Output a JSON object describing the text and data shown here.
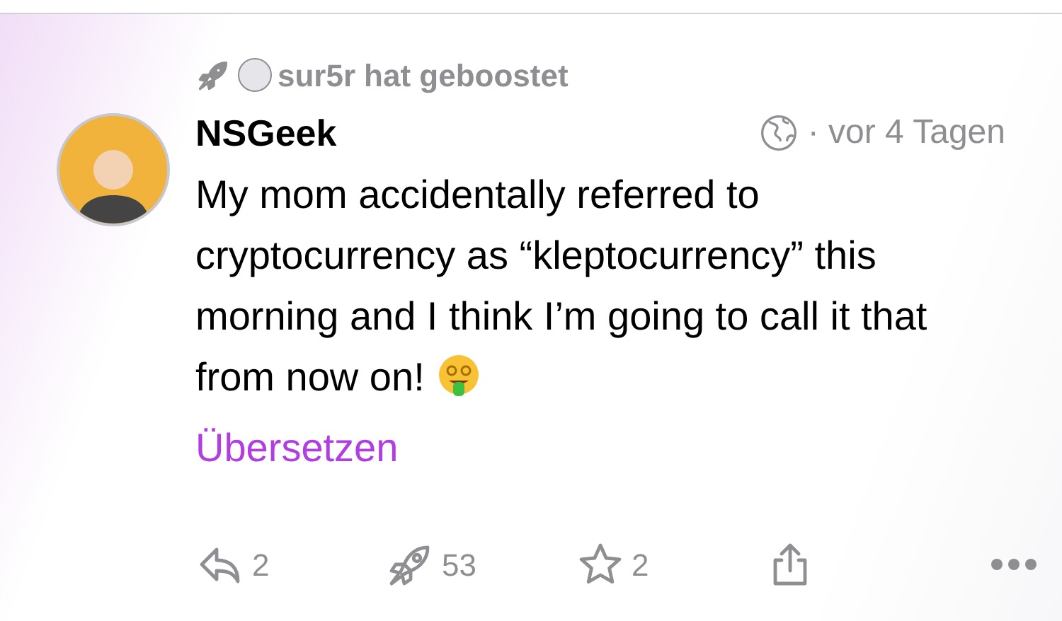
{
  "boost": {
    "user": "sur5r",
    "text": "hat geboostet"
  },
  "post": {
    "author": "NSGeek",
    "time": "· vor 4 Tagen",
    "body": "My mom accidentally referred to cryptocurrency as “kleptocurrency” this morning and I think I’m going to call it that from now on!",
    "translate": "Übersetzen"
  },
  "actions": [
    {
      "kind": "reply",
      "count": "2"
    },
    {
      "kind": "boost",
      "count": "53"
    },
    {
      "kind": "favourite",
      "count": "2"
    },
    {
      "kind": "share"
    },
    {
      "kind": "more"
    }
  ]
}
